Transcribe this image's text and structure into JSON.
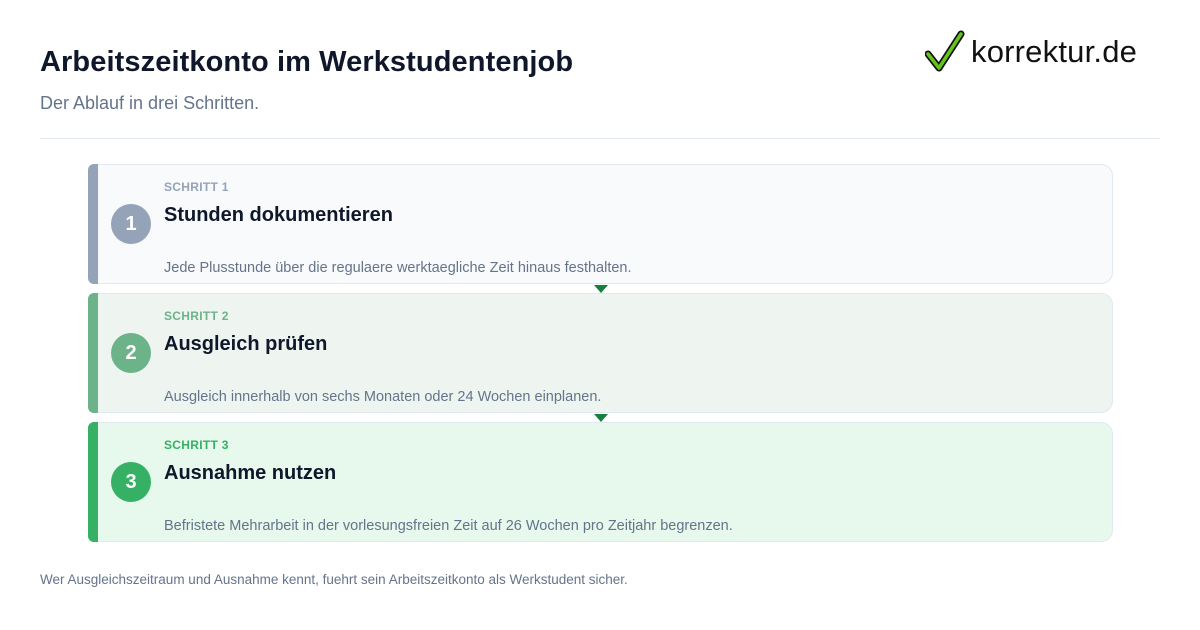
{
  "header": {
    "title": "Arbeitszeitkonto im Werkstudentenjob",
    "subtitle": "Der Ablauf in drei Schritten."
  },
  "logo": {
    "text": "korrektur.de",
    "icon": "checkmark-icon",
    "check_color": "#65c41a"
  },
  "steps": [
    {
      "number": "1",
      "label": "SCHRITT 1",
      "title": "Stunden dokumentieren",
      "description": "Jede Plusstunde über die regulaere werktaegliche Zeit hinaus festhalten.",
      "accent": "#94a3b8"
    },
    {
      "number": "2",
      "label": "SCHRITT 2",
      "title": "Ausgleich prüfen",
      "description": "Ausgleich innerhalb von sechs Monaten oder 24 Wochen einplanen.",
      "accent": "#6db38a"
    },
    {
      "number": "3",
      "label": "SCHRITT 3",
      "title": "Ausnahme nutzen",
      "description": "Befristete Mehrarbeit in der vorlesungsfreien Zeit auf 26 Wochen pro Zeitjahr begrenzen.",
      "accent": "#35b064"
    }
  ],
  "connector": {
    "icon": "arrow-down-icon",
    "color": "#15803d"
  },
  "footer": {
    "text": "Wer Ausgleichszeitraum und Ausnahme kennt, fuehrt sein Arbeitszeitkonto als Werkstudent sicher."
  }
}
